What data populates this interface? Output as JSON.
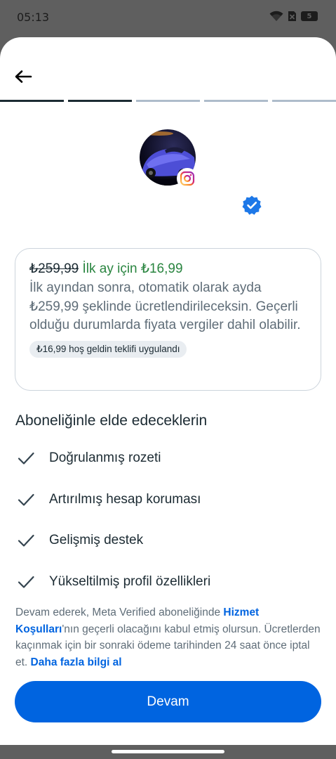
{
  "status_bar": {
    "time": "05:13",
    "battery": "5"
  },
  "progress": {
    "total_steps": 5,
    "current_step": 2
  },
  "offer": {
    "old_price": "₺259,99",
    "new_price": "İlk ay için ₺16,99",
    "description": "İlk ayından sonra, otomatik olarak ayda ₺259,99 şeklinde ücretlendirileceksin. Geçerli olduğu durumlarda fiyata vergiler dahil olabilir.",
    "chip": "₺16,99 hoş geldin teklifi uygulandı"
  },
  "benefits": {
    "title": "Aboneliğinle elde edeceklerin",
    "items": [
      {
        "label": "Doğrulanmış rozeti"
      },
      {
        "label": "Artırılmış hesap koruması"
      },
      {
        "label": "Gelişmiş destek"
      },
      {
        "label": "Yükseltilmiş profil özellikleri"
      }
    ]
  },
  "terms": {
    "text_1": "Devam ederek, Meta Verified aboneliğinde ",
    "link_1": "Hizmet Koşulları",
    "text_2": "'nın geçerli olacağını kabul etmiş olursun. Ücretlerden kaçınmak için bir sonraki ödeme tarihinden 24 saat önce iptal et. ",
    "link_2": "Daha fazla bilgi al"
  },
  "cta": {
    "label": "Devam"
  },
  "colors": {
    "primary": "#0064e0",
    "offer_green": "#2a8540",
    "text_dark": "#1c2b33",
    "text_muted": "#5f6d78"
  },
  "icons": [
    "back-arrow-icon",
    "instagram-icon",
    "verified-badge-icon",
    "check-icon",
    "wifi-icon",
    "no-sim-icon",
    "battery-icon"
  ]
}
